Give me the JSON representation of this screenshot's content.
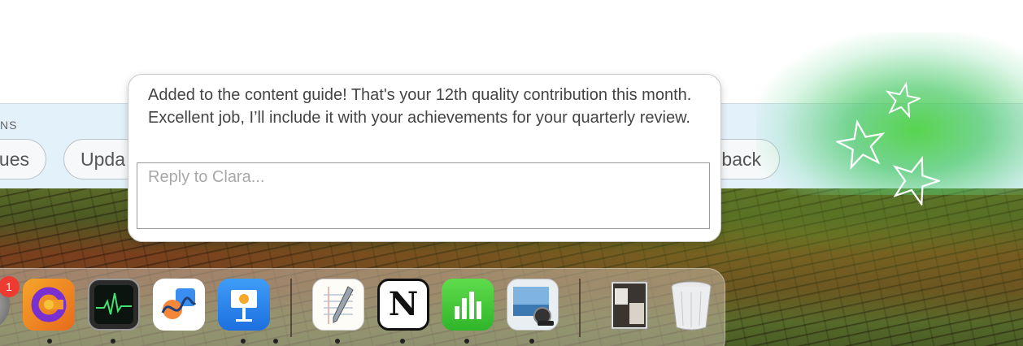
{
  "banner": {
    "section_label": "NS",
    "pills": [
      "ues",
      "Upda",
      "back"
    ]
  },
  "popup": {
    "message": "Added to the content guide! That's your 12th quality contribution this month. Excellent job, I’ll include it with your achievements for your quarterly review.",
    "reply_placeholder": "Reply to Clara..."
  },
  "dock": {
    "badge_count": "1",
    "apps": [
      {
        "name": "system-settings-icon"
      },
      {
        "name": "cursor-app-icon"
      },
      {
        "name": "activity-monitor-icon"
      },
      {
        "name": "freeform-icon"
      },
      {
        "name": "keynote-icon"
      },
      {
        "name": "textedit-icon"
      },
      {
        "name": "notion-icon"
      },
      {
        "name": "numbers-icon"
      },
      {
        "name": "preview-icon"
      },
      {
        "name": "downloads-stack-icon"
      },
      {
        "name": "trash-icon"
      }
    ]
  },
  "colors": {
    "banner_bg": "#e3f1fb",
    "glow": "#4fd24a",
    "badge": "#ee3b32"
  }
}
